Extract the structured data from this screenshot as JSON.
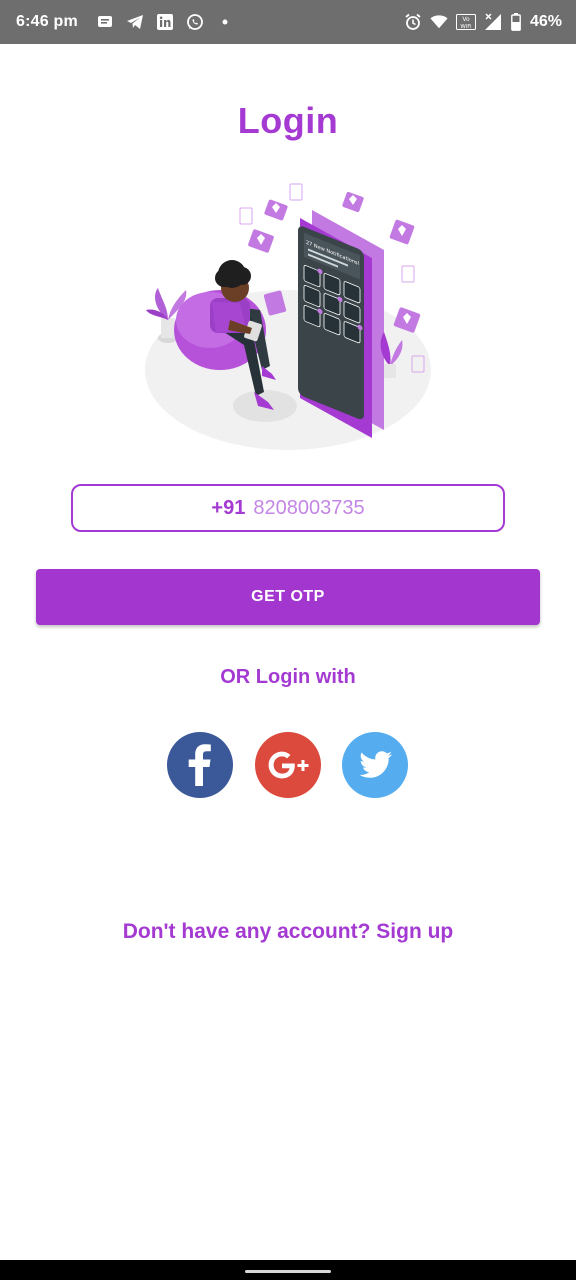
{
  "status_bar": {
    "time": "6:46 pm",
    "battery": "46%",
    "icons_left": [
      "message-icon",
      "telegram-icon",
      "linkedin-icon",
      "whatsapp-icon",
      "dot-icon"
    ],
    "icons_right": [
      "alarm-icon",
      "wifi-icon",
      "vowifi-icon",
      "signal-icon",
      "battery-icon"
    ],
    "vowifi_label": "Vo WiFi"
  },
  "title": "Login",
  "phone": {
    "prefix": "+91",
    "number": "8208003735"
  },
  "otp_button_label": "GET OTP",
  "or_label": "OR Login with",
  "social": [
    {
      "name": "facebook",
      "glyph": "f",
      "color": "#3b5998"
    },
    {
      "name": "google-plus",
      "glyph": "G+",
      "color": "#dc4a3d"
    },
    {
      "name": "twitter",
      "glyph": "twitter-bird",
      "color": "#55acee"
    }
  ],
  "signup_text": "Don't have any account? Sign up",
  "illustration": {
    "notifications_text": "27 New Notifications!",
    "accent": "#a43ad2"
  },
  "colors": {
    "accent": "#a43ad2",
    "status_bar": "#6e6e6e",
    "facebook": "#3b5998",
    "google": "#dc4a3d",
    "twitter": "#55acee"
  }
}
